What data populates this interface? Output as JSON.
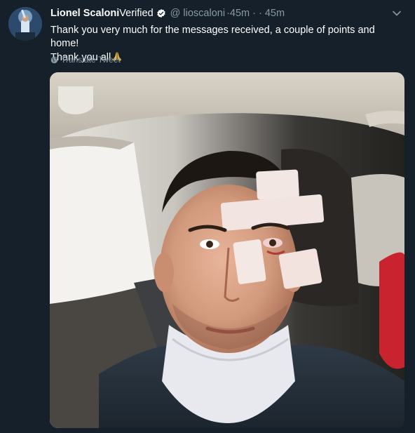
{
  "tweet": {
    "author_name": "Lionel Scaloni",
    "verified_label": "Verified",
    "handle": "@ lioscaloni",
    "meta": "·45m · · 45m",
    "text_line1": "Thank you very much for the messages received, a couple of points and home!",
    "text_line2": "Thank you all",
    "translate_label": "Translate Tweet",
    "icons": {
      "verified": "verified-badge-icon",
      "menu": "chevron-down-icon",
      "translate": "globe-icon",
      "emoji": "folded-hands-emoji"
    }
  },
  "colors": {
    "background": "#15202b",
    "text_primary": "#ffffff",
    "text_secondary": "#8899a6",
    "verified_badge": "#ffffff"
  }
}
